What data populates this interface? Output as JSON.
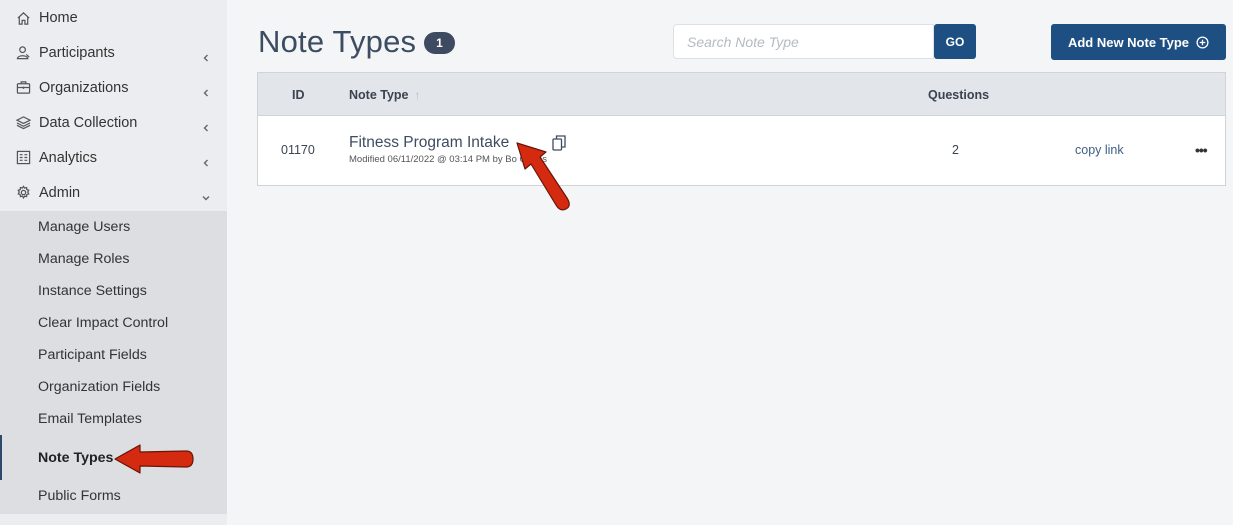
{
  "sidebar": {
    "items": [
      {
        "label": "Home",
        "icon": "home-icon"
      },
      {
        "label": "Participants",
        "icon": "user-icon"
      },
      {
        "label": "Organizations",
        "icon": "briefcase-icon"
      },
      {
        "label": "Data Collection",
        "icon": "layers-icon"
      },
      {
        "label": "Analytics",
        "icon": "analytics-icon"
      },
      {
        "label": "Admin",
        "icon": "gear-icon"
      }
    ],
    "admin_submenu": [
      {
        "label": "Manage Users"
      },
      {
        "label": "Manage Roles"
      },
      {
        "label": "Instance Settings"
      },
      {
        "label": "Clear Impact Control"
      },
      {
        "label": "Participant Fields"
      },
      {
        "label": "Organization Fields"
      },
      {
        "label": "Email Templates"
      },
      {
        "label": "Note Types",
        "active": true
      },
      {
        "label": "Public Forms"
      }
    ]
  },
  "header": {
    "title": "Note Types",
    "count": "1"
  },
  "search": {
    "placeholder": "Search Note Type",
    "go_label": "GO"
  },
  "add_button": {
    "label": "Add New Note Type"
  },
  "table": {
    "columns": {
      "id": "ID",
      "note_type": "Note Type",
      "sort_indicator": "↑",
      "questions": "Questions"
    },
    "rows": [
      {
        "id": "01170",
        "name": "Fitness Program Intake",
        "meta": "Modified 06/11/2022 @ 03:14 PM by Bo Oakes",
        "questions": "2",
        "copy_link": "copy link",
        "more": "•••"
      }
    ]
  },
  "colors": {
    "accent": "#1e4f82",
    "annotation_arrow": "#d42a10"
  }
}
